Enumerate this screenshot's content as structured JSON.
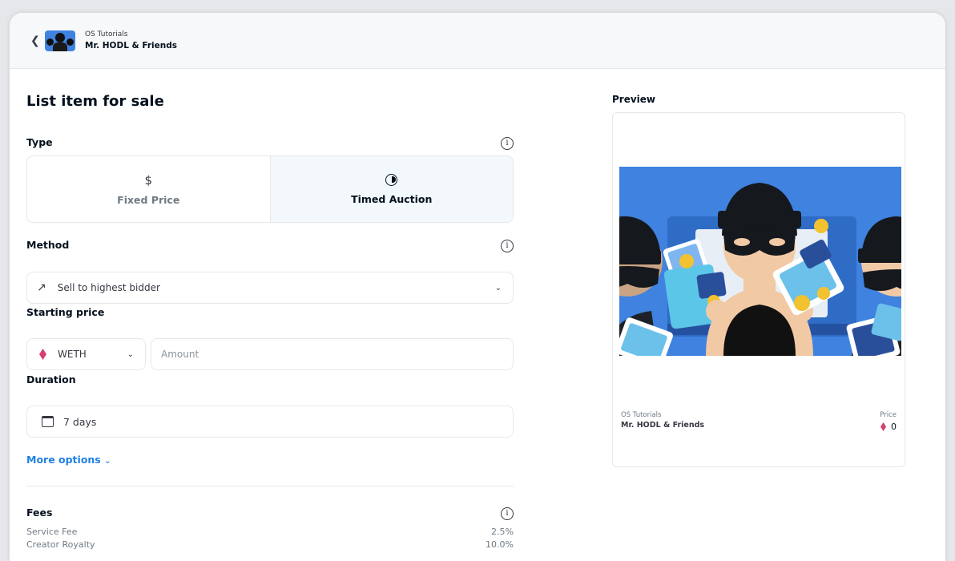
{
  "header": {
    "back_icon": "chevron-left-icon",
    "collection": "OS Tutorials",
    "item_name": "Mr. HODL & Friends"
  },
  "form": {
    "title": "List item for sale",
    "type_label": "Type",
    "type_options": [
      {
        "label": "Fixed Price",
        "icon": "dollar-icon",
        "selected": false
      },
      {
        "label": "Timed Auction",
        "icon": "clock-icon",
        "selected": true
      }
    ],
    "method_label": "Method",
    "method_value": "Sell to highest bidder",
    "starting_price_label": "Starting price",
    "currency": "WETH",
    "amount_placeholder": "Amount",
    "duration_label": "Duration",
    "duration_value": "7 days",
    "more_options": "More options",
    "fees_label": "Fees",
    "fees": [
      {
        "name": "Service Fee",
        "value": "2.5%"
      },
      {
        "name": "Creator Royalty",
        "value": "10.0%"
      }
    ]
  },
  "preview": {
    "label": "Preview",
    "collection": "OS Tutorials",
    "name": "Mr. HODL & Friends",
    "price_label": "Price",
    "price_value": "0"
  },
  "colors": {
    "accent_blue": "#2081e2",
    "eth_pink": "#d83e6e",
    "art_bg": "#3f82e0"
  }
}
